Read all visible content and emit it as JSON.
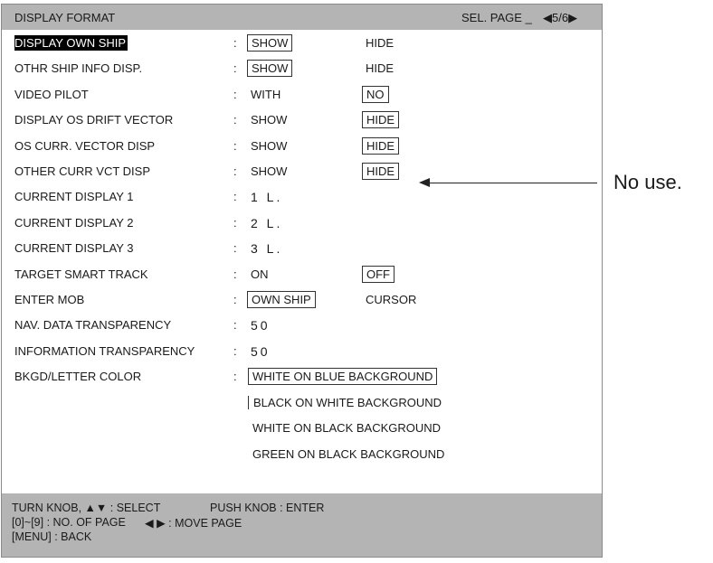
{
  "header": {
    "title": "DISPLAY FORMAT",
    "sel_page": "SEL. PAGE _",
    "pager": "◀5/6▶"
  },
  "rows": [
    {
      "label": "DISPLAY OWN SHIP",
      "opt1": "SHOW",
      "opt2": "HIDE",
      "selected": 1,
      "highlighted": true
    },
    {
      "label": "OTHR SHIP INFO DISP.",
      "opt1": "SHOW",
      "opt2": "HIDE",
      "selected": 1
    },
    {
      "label": "VIDEO PILOT",
      "opt1": "WITH",
      "opt2": "NO",
      "selected": 2
    },
    {
      "label": "DISPLAY OS DRIFT VECTOR",
      "opt1": "SHOW",
      "opt2": "HIDE",
      "selected": 2
    },
    {
      "label": "OS CURR. VECTOR DISP",
      "opt1": "SHOW",
      "opt2": "HIDE",
      "selected": 2
    },
    {
      "label": "OTHER CURR VCT DISP",
      "opt1": "SHOW",
      "opt2": "HIDE",
      "selected": 2
    },
    {
      "label": "CURRENT DISPLAY 1",
      "value": "1 L."
    },
    {
      "label": "CURRENT DISPLAY 2",
      "value": "2 L."
    },
    {
      "label": "CURRENT DISPLAY 3",
      "value": "3 L."
    },
    {
      "label": "TARGET SMART TRACK",
      "opt1": "ON",
      "opt2": "OFF",
      "selected": 2
    },
    {
      "label": "ENTER MOB",
      "opt1": "OWN SHIP",
      "opt2": "CURSOR",
      "selected": 1
    },
    {
      "label": "NAV. DATA TRANSPARENCY",
      "value": "50"
    },
    {
      "label": "INFORMATION TRANSPARENCY",
      "value": "50"
    },
    {
      "label": "BKGD/LETTER COLOR"
    }
  ],
  "color_options": [
    "WHITE ON BLUE BACKGROUND",
    "BLACK ON WHITE BACKGROUND",
    "WHITE ON BLACK BACKGROUND",
    "GREEN ON BLACK BACKGROUND"
  ],
  "color_selected": 0,
  "colon": ":",
  "footer": {
    "line1a": "TURN KNOB, ▲▼ : SELECT",
    "line1b": "PUSH KNOB : ENTER",
    "line2a": "[0]~[9] : NO. OF PAGE",
    "line2b": "◀ ▶ : MOVE PAGE",
    "line3": "[MENU] : BACK"
  },
  "callout": "No use."
}
